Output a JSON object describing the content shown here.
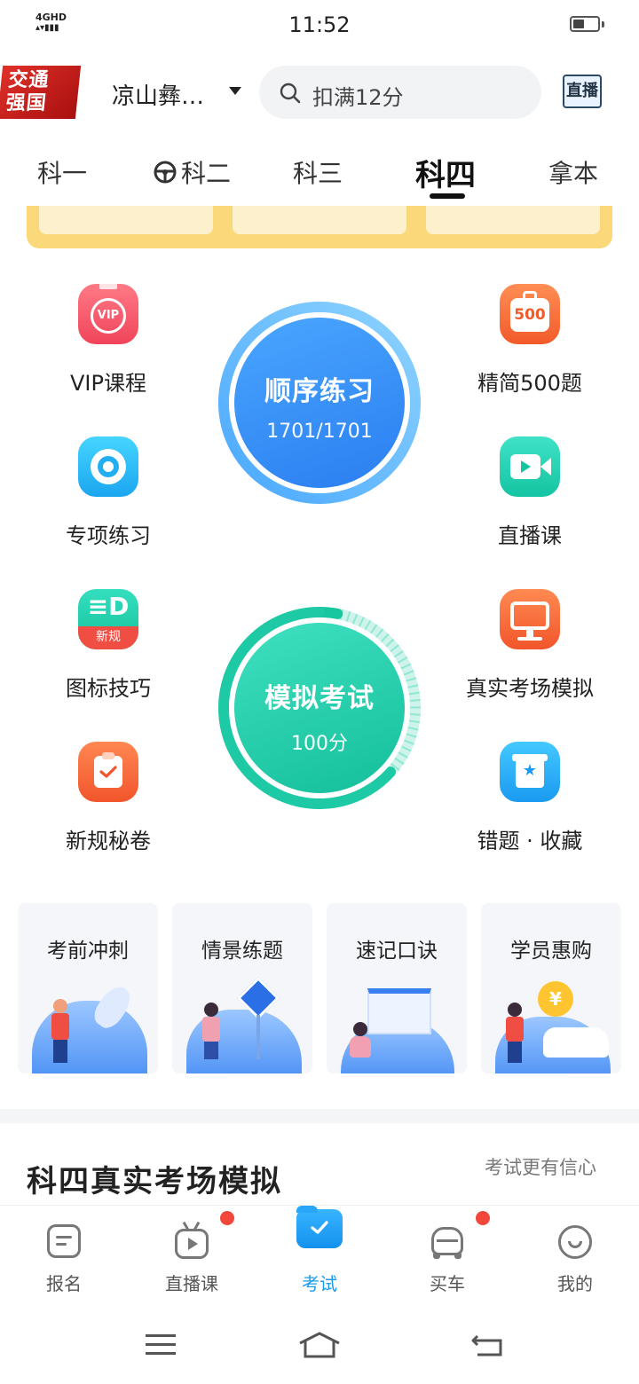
{
  "status_bar": {
    "network": "4GHD",
    "time": "11:52"
  },
  "header": {
    "logo_text": [
      "交通",
      "强国"
    ],
    "city": "凉山彝…",
    "search_placeholder": "扣满12分",
    "live_button": "直播"
  },
  "tabs": [
    "科一",
    "科二",
    "科三",
    "科四",
    "拿本"
  ],
  "active_tab": "科四",
  "features_left": [
    {
      "label": "VIP课程",
      "icon": "vip-icon",
      "badge": "VIP"
    },
    {
      "label": "专项练习",
      "icon": "target-icon"
    },
    {
      "label": "图标技巧",
      "icon": "sign-icon",
      "badge": "新规"
    },
    {
      "label": "新规秘卷",
      "icon": "clipboard-check-icon"
    }
  ],
  "features_right": [
    {
      "label": "精简500题",
      "icon": "500-icon",
      "badge": "500"
    },
    {
      "label": "直播课",
      "icon": "video-icon"
    },
    {
      "label": "真实考场模拟",
      "icon": "monitor-icon"
    },
    {
      "label": "错题 · 收藏",
      "icon": "bookmark-star-icon"
    }
  ],
  "practice": {
    "title": "顺序练习",
    "progress": "1701/1701",
    "progress_fraction": 1.0
  },
  "exam": {
    "title": "模拟考试",
    "score": "100分",
    "progress_fraction": 0.03
  },
  "cards": [
    "考前冲刺",
    "情景练题",
    "速记口诀",
    "学员惠购"
  ],
  "section": {
    "title": "科四真实考场模拟",
    "subtitle": "考试更有信心"
  },
  "bottom_nav": [
    {
      "label": "报名",
      "icon": "form-icon",
      "badge": false
    },
    {
      "label": "直播课",
      "icon": "tv-icon",
      "badge": true
    },
    {
      "label": "考试",
      "icon": "exam-folder-icon",
      "badge": false,
      "active": true
    },
    {
      "label": "买车",
      "icon": "car-icon",
      "badge": true
    },
    {
      "label": "我的",
      "icon": "profile-smile-icon",
      "badge": false
    }
  ],
  "colors": {
    "accent_blue": "#1a9bf0",
    "practice_blue": "#3a8ef5",
    "exam_green": "#1ec7a4",
    "badge_red": "#f2473b"
  }
}
